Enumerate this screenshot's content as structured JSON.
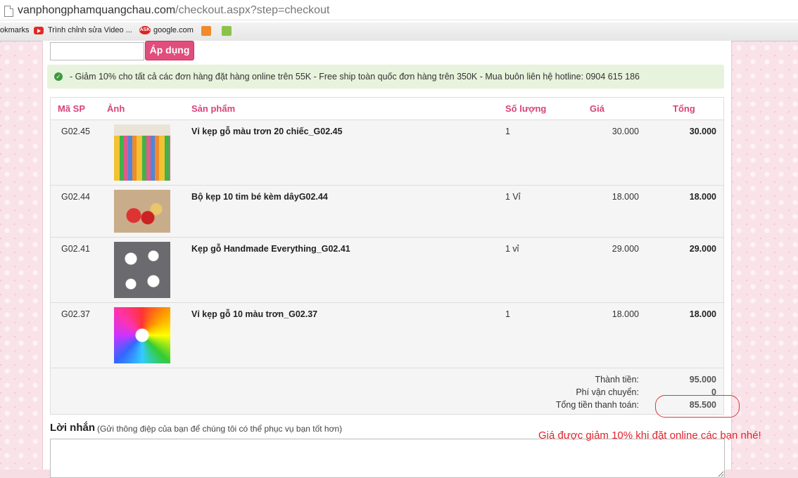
{
  "browser": {
    "url_host": "vanphongphamquangchau.com",
    "url_path": "/checkout.aspx?step=checkout",
    "bookmarks": [
      {
        "label": "okmarks"
      },
      {
        "label": "Trình chỉnh sửa Video ..."
      },
      {
        "label": "google.com"
      }
    ]
  },
  "coupon": {
    "value": "",
    "apply_label": "Áp dụng"
  },
  "notice": "- Giảm 10% cho tất cả các đơn hàng đặt hàng online trên 55K - Free ship toàn quốc đơn hàng trên 350K - Mua buôn liên hệ hotline: 0904 615 186",
  "cart": {
    "headers": {
      "sku": "Mã SP",
      "image": "Ảnh",
      "product": "Sản phẩm",
      "qty": "Số lượng",
      "price": "Giá",
      "total": "Tổng"
    },
    "items": [
      {
        "sku": "G02.45",
        "name": "Vỉ kẹp gỗ màu trơn 20 chiếc_G02.45",
        "qty": "1",
        "price": "30.000",
        "total": "30.000"
      },
      {
        "sku": "G02.44",
        "name": "Bộ kẹp 10 tim bé kèm dâyG02.44",
        "qty": "1 Vỉ",
        "price": "18.000",
        "total": "18.000"
      },
      {
        "sku": "G02.41",
        "name": "Kẹp gỗ Handmade Everything_G02.41",
        "qty": "1 vỉ",
        "price": "29.000",
        "total": "29.000"
      },
      {
        "sku": "G02.37",
        "name": "Vỉ kẹp gỗ 10 màu trơn_G02.37",
        "qty": "1",
        "price": "18.000",
        "total": "18.000"
      }
    ],
    "summary": {
      "subtotal_label": "Thành tiền:",
      "subtotal": "95.000",
      "shipping_label": "Phí vận chuyển:",
      "shipping": "0",
      "grand_label": "Tổng tiền thanh toán:",
      "grand": "85.500"
    }
  },
  "message": {
    "label": "Lời nhắn",
    "hint": "(Gửi thông điệp của bạn để chúng tôi có thể phục vụ bạn tốt hơn)",
    "value": ""
  },
  "annotation": "Giá được giảm 10% khi đặt online các bạn nhé!",
  "colors": {
    "accent": "#e14d7d",
    "header_text": "#d8437a",
    "notice_bg": "#e7f3dc",
    "annotation": "#e4232a"
  }
}
